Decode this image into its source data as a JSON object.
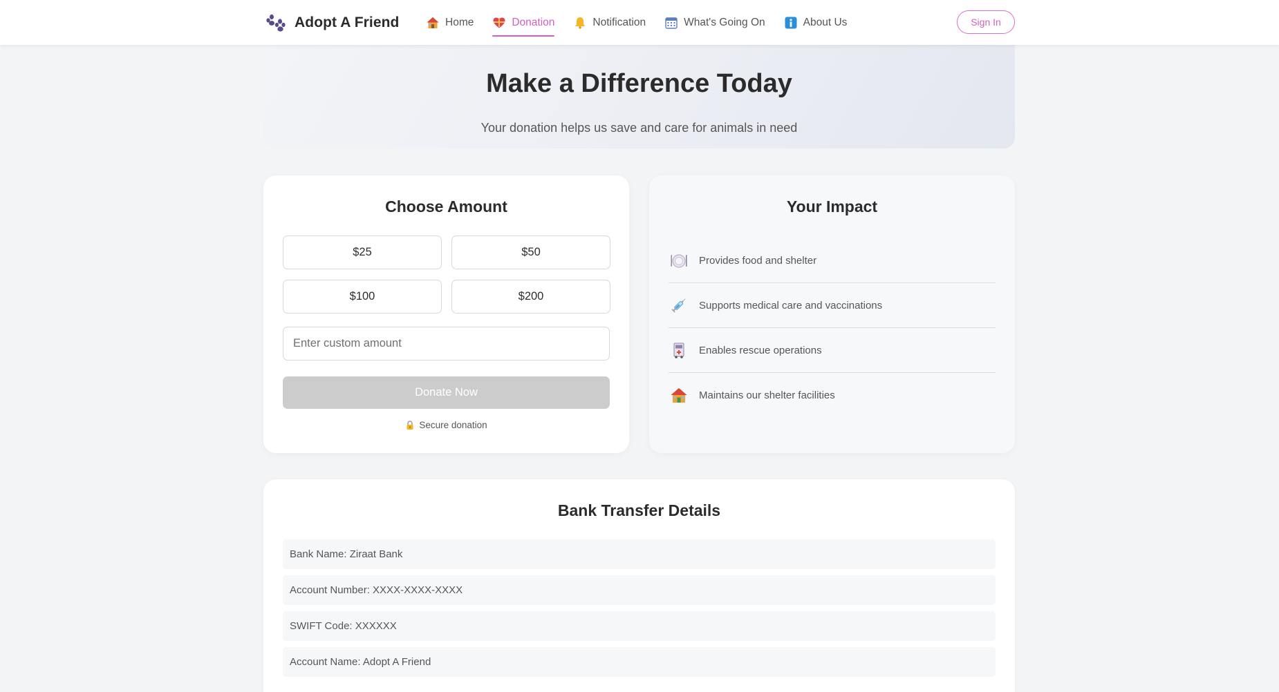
{
  "header": {
    "brand_name": "Adopt A Friend",
    "brand_icon": "paw-icon",
    "nav": [
      {
        "label": "Home",
        "icon": "house-icon"
      },
      {
        "label": "Donation",
        "icon": "heart-gift-icon",
        "active": true
      },
      {
        "label": "Notification",
        "icon": "bell-icon"
      },
      {
        "label": "What's Going On",
        "icon": "calendar-icon"
      },
      {
        "label": "About Us",
        "icon": "info-icon"
      }
    ],
    "signin_label": "Sign In"
  },
  "hero": {
    "title": "Make a Difference Today",
    "subtitle": "Your donation helps us save and care for animals in need"
  },
  "amount": {
    "title": "Choose Amount",
    "options": [
      "$25",
      "$50",
      "$100",
      "$200"
    ],
    "custom_placeholder": "Enter custom amount",
    "donate_label": "Donate Now",
    "secure_label": "Secure donation"
  },
  "impact": {
    "title": "Your Impact",
    "items": [
      {
        "text": "Provides food and shelter",
        "icon": "plate-icon"
      },
      {
        "text": "Supports medical care and vaccinations",
        "icon": "syringe-icon"
      },
      {
        "text": "Enables rescue operations",
        "icon": "ambulance-icon"
      },
      {
        "text": "Maintains our shelter facilities",
        "icon": "house-icon"
      }
    ]
  },
  "bank": {
    "title": "Bank Transfer Details",
    "rows": [
      "Bank Name: Ziraat Bank",
      "Account Number: XXXX-XXXX-XXXX",
      "SWIFT Code: XXXXXX",
      "Account Name: Adopt A Friend"
    ]
  },
  "colors": {
    "accent": "#d15fc3",
    "disabled_button": "#cccccc",
    "background": "#f3f4f6"
  }
}
